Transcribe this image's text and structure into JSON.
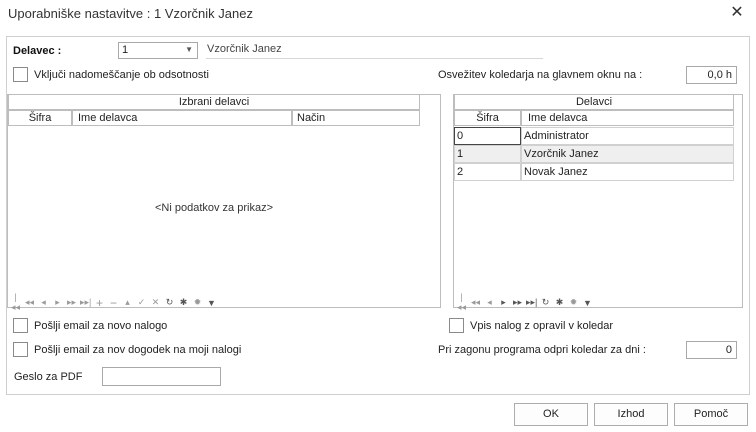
{
  "window": {
    "title": "Uporabniške nastavitve : 1 Vzorčnik Janez"
  },
  "delavec": {
    "label": "Delavec :",
    "value": "1",
    "name": "Vzorčnik Janez"
  },
  "options": {
    "vkljuci_label": "Vključi nadomeščanje ob odsotnosti",
    "osvezitev_label": "Osvežitev koledarja na glavnem oknu na :",
    "osvezitev_value": "0,0 h",
    "email_nalog_label": "Pošlji email za novo nalogo",
    "email_dogodek_label": "Pošlji email za nov dogodek na moji nalogi",
    "vpis_label": "Vpis nalog z opravil v koledar",
    "zagon_label": "Pri zagonu programa odpri koledar za dni :",
    "zagon_value": "0",
    "geslo_label": "Geslo za PDF"
  },
  "left_grid": {
    "band": "Izbrani delavci",
    "columns": [
      "Šifra",
      "Ime delavca",
      "Način"
    ],
    "empty_text": "<Ni podatkov za prikaz>"
  },
  "right_grid": {
    "band": "Delavci",
    "columns": [
      "Šifra",
      "Ime delavca"
    ],
    "rows": [
      {
        "sifra": "0",
        "ime": "Administrator"
      },
      {
        "sifra": "1",
        "ime": "Vzorčnik Janez"
      },
      {
        "sifra": "2",
        "ime": "Novak Janez"
      }
    ]
  },
  "buttons": {
    "ok": "OK",
    "izhod": "Izhod",
    "pomoc": "Pomoč"
  },
  "icons": {
    "close": "close-icon",
    "nav_first": "first-record-icon",
    "nav_prev_page": "previous-page-icon",
    "nav_prev": "previous-record-icon",
    "nav_next": "next-record-icon",
    "nav_next_page": "next-page-icon",
    "nav_last": "last-record-icon",
    "insert": "insert-icon",
    "delete": "delete-icon",
    "edit": "edit-icon",
    "post": "post-icon",
    "cancel": "cancel-icon",
    "refresh": "refresh-icon",
    "bookmark": "bookmark-icon",
    "goto_bookmark": "goto-bookmark-icon",
    "filter": "filter-icon"
  }
}
